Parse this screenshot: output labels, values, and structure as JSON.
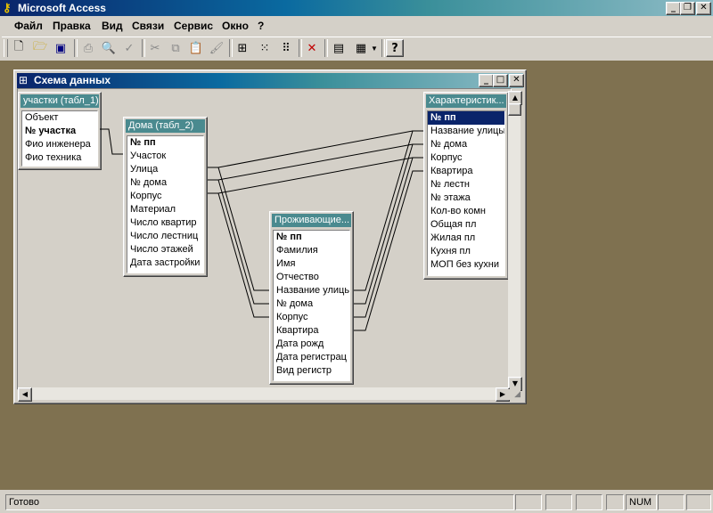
{
  "app": {
    "title": "Microsoft Access"
  },
  "menu": [
    "Файл",
    "Правка",
    "Вид",
    "Связи",
    "Сервис",
    "Окно",
    "?"
  ],
  "window": {
    "title": "Схема данных"
  },
  "tables": [
    {
      "title": "участки (табл_1)",
      "fields": [
        "Объект",
        "№ участка",
        "Фио инженера",
        "Фио техника"
      ],
      "pk": [
        1
      ]
    },
    {
      "title": "Дома (табл_2)",
      "fields": [
        "№ пп",
        "Участок",
        "Улица",
        "№ дома",
        "Корпус",
        "Материал",
        "Число квартир",
        "Число лестниц",
        "Число этажей",
        "Дата застройки"
      ],
      "pk": [
        0
      ]
    },
    {
      "title": "Проживающие...",
      "fields": [
        "№ пп",
        "Фамилия",
        "Имя",
        "Отчество",
        "Название улицы",
        "№ дома",
        "Корпус",
        "Квартира",
        "Дата рожд",
        "Дата регистрац",
        "Вид регистр"
      ],
      "pk": [
        0
      ]
    },
    {
      "title": "Характеристик...",
      "fields": [
        "№ пп",
        "Название улицы",
        "№ дома",
        "Корпус",
        "Квартира",
        "№ лестн",
        "№ этажа",
        "Кол-во комн",
        "Общая пл",
        "Жилая пл",
        "Кухня пл",
        "МОП без кухни"
      ],
      "pk": [
        0
      ],
      "selected": 0
    }
  ],
  "status": {
    "text": "Готово",
    "num": "NUM"
  }
}
